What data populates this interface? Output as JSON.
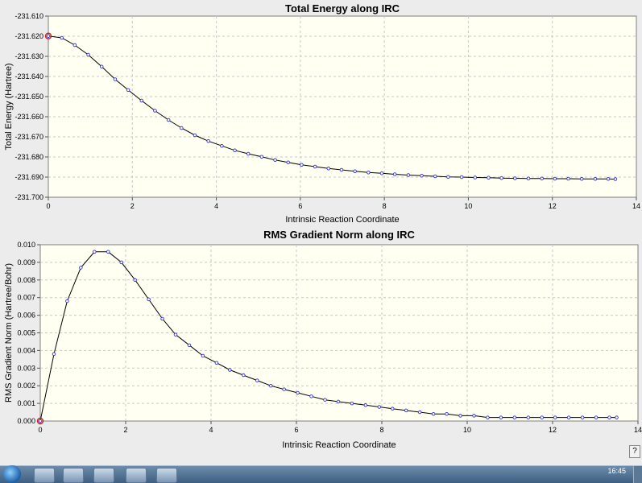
{
  "charts": [
    {
      "title": "Total Energy along IRC",
      "xlabel": "Intrinsic Reaction Coordinate",
      "ylabel": "Total Energy (Hartree)",
      "xticks": [
        "0",
        "2",
        "4",
        "6",
        "8",
        "10",
        "12",
        "14"
      ],
      "yticks": [
        "-231.610",
        "-231.620",
        "-231.630",
        "-231.640",
        "-231.650",
        "-231.660",
        "-231.670",
        "-231.680",
        "-231.690",
        "-231.700"
      ]
    },
    {
      "title": "RMS Gradient Norm along IRC",
      "xlabel": "Intrinsic Reaction Coordinate",
      "ylabel": "RMS Gradient Norm (Hartree/Bohr)",
      "xticks": [
        "0",
        "2",
        "4",
        "6",
        "8",
        "10",
        "12",
        "14"
      ],
      "yticks": [
        "0.010",
        "0.009",
        "0.008",
        "0.007",
        "0.006",
        "0.005",
        "0.004",
        "0.003",
        "0.002",
        "0.001",
        "0.000"
      ]
    }
  ],
  "chart_data": [
    {
      "type": "line",
      "title": "Total Energy along IRC",
      "xlabel": "Intrinsic Reaction Coordinate",
      "ylabel": "Total Energy (Hartree)",
      "xlim": [
        0,
        14
      ],
      "ylim": [
        -231.7,
        -231.61
      ],
      "grid": true,
      "highlight_index": 0,
      "series": [
        {
          "x": [
            0,
            0.32,
            0.63,
            0.95,
            1.27,
            1.59,
            1.9,
            2.22,
            2.54,
            2.86,
            3.17,
            3.49,
            3.81,
            4.13,
            4.44,
            4.76,
            5.08,
            5.4,
            5.71,
            6.03,
            6.35,
            6.67,
            6.98,
            7.3,
            7.62,
            7.94,
            8.25,
            8.57,
            8.89,
            9.21,
            9.52,
            9.84,
            10.16,
            10.48,
            10.79,
            11.11,
            11.43,
            11.75,
            12.06,
            12.38,
            12.7,
            13.02,
            13.33,
            13.5
          ],
          "y": [
            -231.6199,
            -231.6208,
            -231.6244,
            -231.6292,
            -231.6351,
            -231.6414,
            -231.6467,
            -231.652,
            -231.657,
            -231.6616,
            -231.6656,
            -231.6692,
            -231.6721,
            -231.6745,
            -231.6767,
            -231.6784,
            -231.6799,
            -231.6815,
            -231.6827,
            -231.6839,
            -231.6848,
            -231.6857,
            -231.6864,
            -231.6871,
            -231.6877,
            -231.6881,
            -231.6886,
            -231.689,
            -231.6893,
            -231.6896,
            -231.6899,
            -231.69,
            -231.6902,
            -231.6903,
            -231.6905,
            -231.6906,
            -231.6907,
            -231.6907,
            -231.6908,
            -231.6908,
            -231.6909,
            -231.6909,
            -231.6909,
            -231.691
          ]
        }
      ]
    },
    {
      "type": "line",
      "title": "RMS Gradient Norm along IRC",
      "xlabel": "Intrinsic Reaction Coordinate",
      "ylabel": "RMS Gradient Norm (Hartree/Bohr)",
      "xlim": [
        0,
        14
      ],
      "ylim": [
        0,
        0.01
      ],
      "grid": true,
      "highlight_index": 0,
      "series": [
        {
          "x": [
            0,
            0.32,
            0.63,
            0.95,
            1.27,
            1.59,
            1.9,
            2.22,
            2.54,
            2.86,
            3.17,
            3.49,
            3.81,
            4.13,
            4.44,
            4.76,
            5.08,
            5.4,
            5.71,
            6.03,
            6.35,
            6.67,
            6.98,
            7.3,
            7.62,
            7.94,
            8.25,
            8.57,
            8.89,
            9.21,
            9.52,
            9.84,
            10.16,
            10.48,
            10.79,
            11.11,
            11.43,
            11.75,
            12.06,
            12.38,
            12.7,
            13.02,
            13.33,
            13.5
          ],
          "y": [
            0.0,
            0.0038,
            0.0068,
            0.0087,
            0.0096,
            0.0096,
            0.009,
            0.008,
            0.0069,
            0.0058,
            0.0049,
            0.0043,
            0.0037,
            0.0033,
            0.0029,
            0.0026,
            0.0023,
            0.002,
            0.0018,
            0.0016,
            0.0014,
            0.0012,
            0.0011,
            0.001,
            0.0009,
            0.0008,
            0.0007,
            0.0006,
            0.0005,
            0.0004,
            0.0004,
            0.0003,
            0.0003,
            0.0002,
            0.0002,
            0.0002,
            0.0002,
            0.0002,
            0.0002,
            0.0002,
            0.0002,
            0.0002,
            0.0002,
            0.0002
          ]
        }
      ]
    }
  ],
  "taskbar": {
    "time": "16:45"
  },
  "colors": {
    "plot_bg": "#fffff2",
    "line": "#000000",
    "marker": "#3333cc",
    "highlight": "#cc2222"
  }
}
